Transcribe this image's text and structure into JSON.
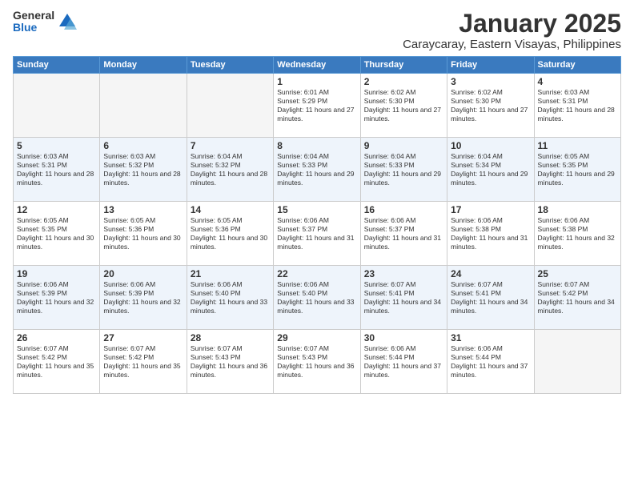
{
  "header": {
    "logo_general": "General",
    "logo_blue": "Blue",
    "month_title": "January 2025",
    "location": "Caraycaray, Eastern Visayas, Philippines"
  },
  "weekdays": [
    "Sunday",
    "Monday",
    "Tuesday",
    "Wednesday",
    "Thursday",
    "Friday",
    "Saturday"
  ],
  "weeks": [
    [
      {
        "day": "",
        "sunrise": "",
        "sunset": "",
        "daylight": ""
      },
      {
        "day": "",
        "sunrise": "",
        "sunset": "",
        "daylight": ""
      },
      {
        "day": "",
        "sunrise": "",
        "sunset": "",
        "daylight": ""
      },
      {
        "day": "1",
        "sunrise": "Sunrise: 6:01 AM",
        "sunset": "Sunset: 5:29 PM",
        "daylight": "Daylight: 11 hours and 27 minutes."
      },
      {
        "day": "2",
        "sunrise": "Sunrise: 6:02 AM",
        "sunset": "Sunset: 5:30 PM",
        "daylight": "Daylight: 11 hours and 27 minutes."
      },
      {
        "day": "3",
        "sunrise": "Sunrise: 6:02 AM",
        "sunset": "Sunset: 5:30 PM",
        "daylight": "Daylight: 11 hours and 27 minutes."
      },
      {
        "day": "4",
        "sunrise": "Sunrise: 6:03 AM",
        "sunset": "Sunset: 5:31 PM",
        "daylight": "Daylight: 11 hours and 28 minutes."
      }
    ],
    [
      {
        "day": "5",
        "sunrise": "Sunrise: 6:03 AM",
        "sunset": "Sunset: 5:31 PM",
        "daylight": "Daylight: 11 hours and 28 minutes."
      },
      {
        "day": "6",
        "sunrise": "Sunrise: 6:03 AM",
        "sunset": "Sunset: 5:32 PM",
        "daylight": "Daylight: 11 hours and 28 minutes."
      },
      {
        "day": "7",
        "sunrise": "Sunrise: 6:04 AM",
        "sunset": "Sunset: 5:32 PM",
        "daylight": "Daylight: 11 hours and 28 minutes."
      },
      {
        "day": "8",
        "sunrise": "Sunrise: 6:04 AM",
        "sunset": "Sunset: 5:33 PM",
        "daylight": "Daylight: 11 hours and 29 minutes."
      },
      {
        "day": "9",
        "sunrise": "Sunrise: 6:04 AM",
        "sunset": "Sunset: 5:33 PM",
        "daylight": "Daylight: 11 hours and 29 minutes."
      },
      {
        "day": "10",
        "sunrise": "Sunrise: 6:04 AM",
        "sunset": "Sunset: 5:34 PM",
        "daylight": "Daylight: 11 hours and 29 minutes."
      },
      {
        "day": "11",
        "sunrise": "Sunrise: 6:05 AM",
        "sunset": "Sunset: 5:35 PM",
        "daylight": "Daylight: 11 hours and 29 minutes."
      }
    ],
    [
      {
        "day": "12",
        "sunrise": "Sunrise: 6:05 AM",
        "sunset": "Sunset: 5:35 PM",
        "daylight": "Daylight: 11 hours and 30 minutes."
      },
      {
        "day": "13",
        "sunrise": "Sunrise: 6:05 AM",
        "sunset": "Sunset: 5:36 PM",
        "daylight": "Daylight: 11 hours and 30 minutes."
      },
      {
        "day": "14",
        "sunrise": "Sunrise: 6:05 AM",
        "sunset": "Sunset: 5:36 PM",
        "daylight": "Daylight: 11 hours and 30 minutes."
      },
      {
        "day": "15",
        "sunrise": "Sunrise: 6:06 AM",
        "sunset": "Sunset: 5:37 PM",
        "daylight": "Daylight: 11 hours and 31 minutes."
      },
      {
        "day": "16",
        "sunrise": "Sunrise: 6:06 AM",
        "sunset": "Sunset: 5:37 PM",
        "daylight": "Daylight: 11 hours and 31 minutes."
      },
      {
        "day": "17",
        "sunrise": "Sunrise: 6:06 AM",
        "sunset": "Sunset: 5:38 PM",
        "daylight": "Daylight: 11 hours and 31 minutes."
      },
      {
        "day": "18",
        "sunrise": "Sunrise: 6:06 AM",
        "sunset": "Sunset: 5:38 PM",
        "daylight": "Daylight: 11 hours and 32 minutes."
      }
    ],
    [
      {
        "day": "19",
        "sunrise": "Sunrise: 6:06 AM",
        "sunset": "Sunset: 5:39 PM",
        "daylight": "Daylight: 11 hours and 32 minutes."
      },
      {
        "day": "20",
        "sunrise": "Sunrise: 6:06 AM",
        "sunset": "Sunset: 5:39 PM",
        "daylight": "Daylight: 11 hours and 32 minutes."
      },
      {
        "day": "21",
        "sunrise": "Sunrise: 6:06 AM",
        "sunset": "Sunset: 5:40 PM",
        "daylight": "Daylight: 11 hours and 33 minutes."
      },
      {
        "day": "22",
        "sunrise": "Sunrise: 6:06 AM",
        "sunset": "Sunset: 5:40 PM",
        "daylight": "Daylight: 11 hours and 33 minutes."
      },
      {
        "day": "23",
        "sunrise": "Sunrise: 6:07 AM",
        "sunset": "Sunset: 5:41 PM",
        "daylight": "Daylight: 11 hours and 34 minutes."
      },
      {
        "day": "24",
        "sunrise": "Sunrise: 6:07 AM",
        "sunset": "Sunset: 5:41 PM",
        "daylight": "Daylight: 11 hours and 34 minutes."
      },
      {
        "day": "25",
        "sunrise": "Sunrise: 6:07 AM",
        "sunset": "Sunset: 5:42 PM",
        "daylight": "Daylight: 11 hours and 34 minutes."
      }
    ],
    [
      {
        "day": "26",
        "sunrise": "Sunrise: 6:07 AM",
        "sunset": "Sunset: 5:42 PM",
        "daylight": "Daylight: 11 hours and 35 minutes."
      },
      {
        "day": "27",
        "sunrise": "Sunrise: 6:07 AM",
        "sunset": "Sunset: 5:42 PM",
        "daylight": "Daylight: 11 hours and 35 minutes."
      },
      {
        "day": "28",
        "sunrise": "Sunrise: 6:07 AM",
        "sunset": "Sunset: 5:43 PM",
        "daylight": "Daylight: 11 hours and 36 minutes."
      },
      {
        "day": "29",
        "sunrise": "Sunrise: 6:07 AM",
        "sunset": "Sunset: 5:43 PM",
        "daylight": "Daylight: 11 hours and 36 minutes."
      },
      {
        "day": "30",
        "sunrise": "Sunrise: 6:06 AM",
        "sunset": "Sunset: 5:44 PM",
        "daylight": "Daylight: 11 hours and 37 minutes."
      },
      {
        "day": "31",
        "sunrise": "Sunrise: 6:06 AM",
        "sunset": "Sunset: 5:44 PM",
        "daylight": "Daylight: 11 hours and 37 minutes."
      },
      {
        "day": "",
        "sunrise": "",
        "sunset": "",
        "daylight": ""
      }
    ]
  ]
}
